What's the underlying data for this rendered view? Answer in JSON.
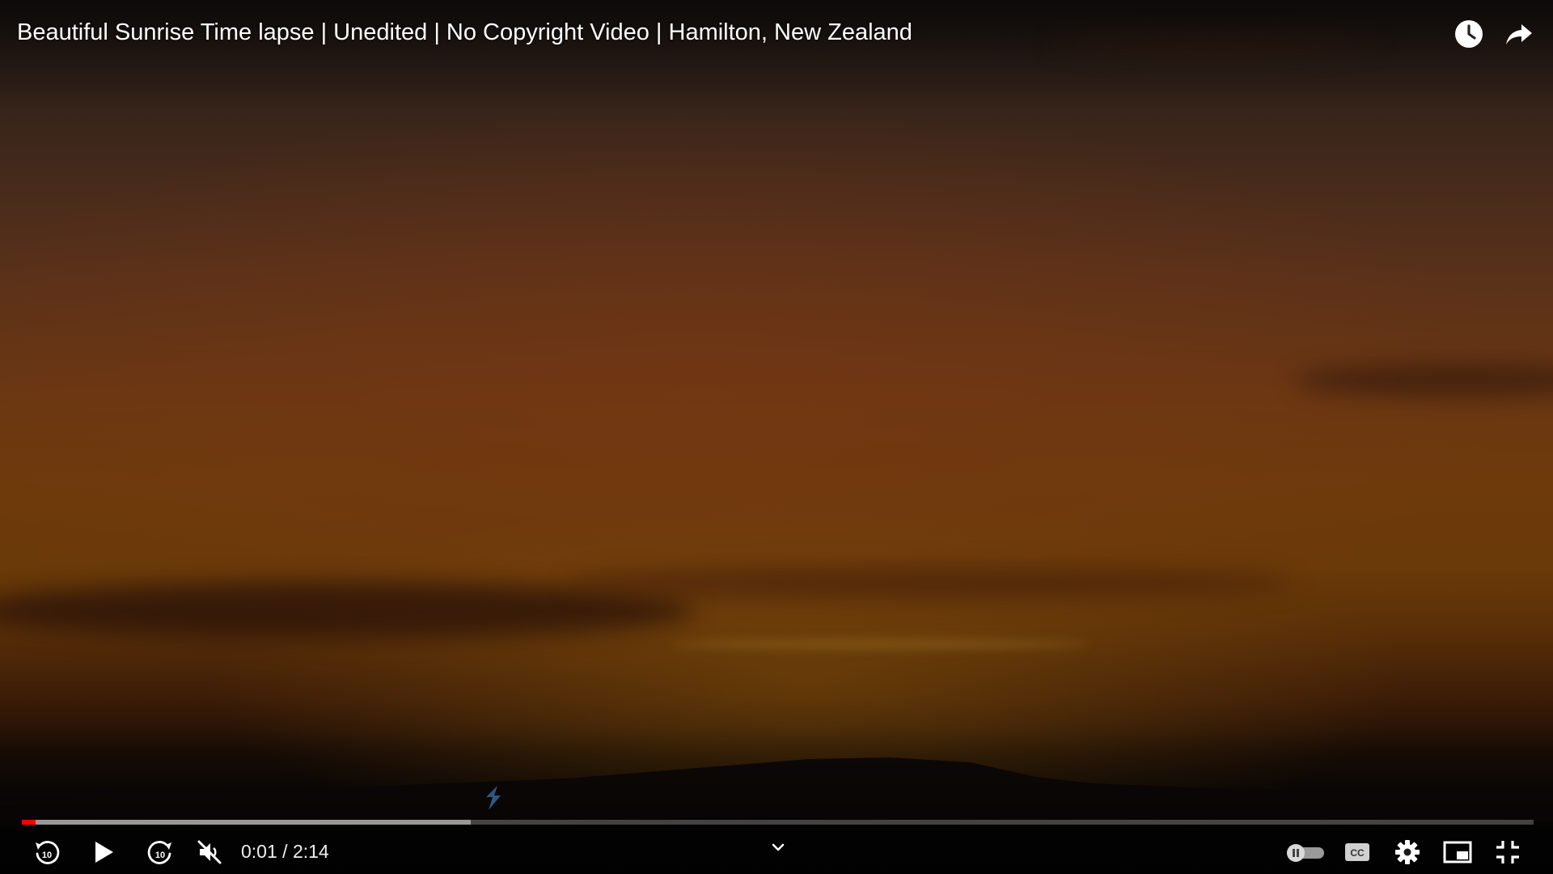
{
  "video": {
    "title": "Beautiful Sunrise Time lapse | Unedited | No Copyright Video | Hamilton, New Zealand"
  },
  "top_actions": {
    "watch_later_icon": "clock-icon",
    "share_icon": "share-arrow-icon"
  },
  "playback": {
    "current_time": "0:01",
    "separator": " / ",
    "duration": "2:14",
    "time_display": "0:01 / 2:14",
    "played_fraction": 0.009,
    "buffered_fraction": 0.297
  },
  "controls": {
    "left": [
      "replay-10-icon",
      "play-icon",
      "forward-10-icon",
      "volume-muted-icon"
    ],
    "center": [
      "chevron-down-icon"
    ],
    "right": [
      "autoplay-toggle-icon",
      "captions-icon",
      "settings-gear-icon",
      "miniplayer-icon",
      "exit-fullscreen-icon"
    ]
  },
  "colors": {
    "progress_played": "#ff0000",
    "progress_buffered": "#ffffff73",
    "text": "#ffffff"
  }
}
